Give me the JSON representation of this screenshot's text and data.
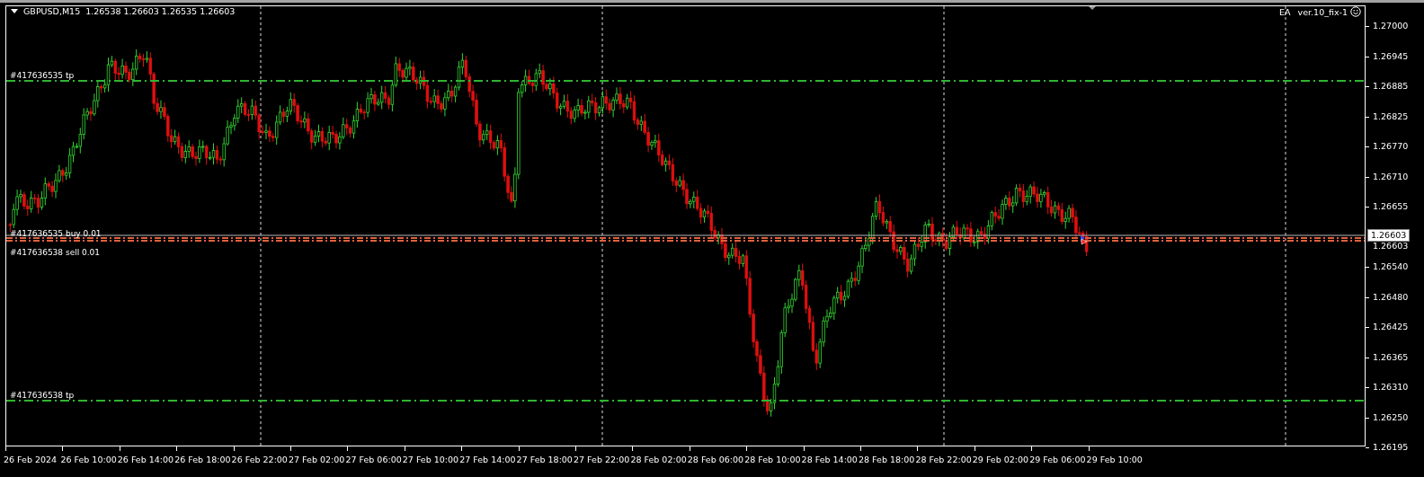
{
  "header": {
    "symbol": "GBPUSD,M15",
    "quotes": "1.26538 1.26603 1.26535 1.26603"
  },
  "expert": {
    "label": "EA",
    "version": "ver.10_fix-1"
  },
  "order_lines": [
    {
      "label": "#417636535 tp",
      "kind": "tp",
      "color": "#2fb52f"
    },
    {
      "label": "#417636535 buy 0.01",
      "kind": "buy",
      "color": "#e0603a"
    },
    {
      "label": "#417636538 sell 0.01",
      "kind": "sell",
      "color": "#e0603a"
    },
    {
      "label": "#417636538 tp",
      "kind": "tp",
      "color": "#2fb52f"
    }
  ],
  "current_price": "1.26603",
  "price_axis": [
    "1.27000",
    "1.26945",
    "1.26885",
    "1.26825",
    "1.26770",
    "1.26710",
    "1.26655",
    "1.26603",
    "1.26540",
    "1.26480",
    "1.26425",
    "1.26365",
    "1.26310",
    "1.26250",
    "1.26195"
  ],
  "time_axis": [
    "26 Feb 2024",
    "26 Feb 10:00",
    "26 Feb 14:00",
    "26 Feb 18:00",
    "26 Feb 22:00",
    "27 Feb 02:00",
    "27 Feb 06:00",
    "27 Feb 10:00",
    "27 Feb 14:00",
    "27 Feb 18:00",
    "27 Feb 22:00",
    "28 Feb 02:00",
    "28 Feb 06:00",
    "28 Feb 10:00",
    "28 Feb 14:00",
    "28 Feb 18:00",
    "28 Feb 22:00",
    "29 Feb 02:00",
    "29 Feb 06:00",
    "29 Feb 10:00"
  ]
}
